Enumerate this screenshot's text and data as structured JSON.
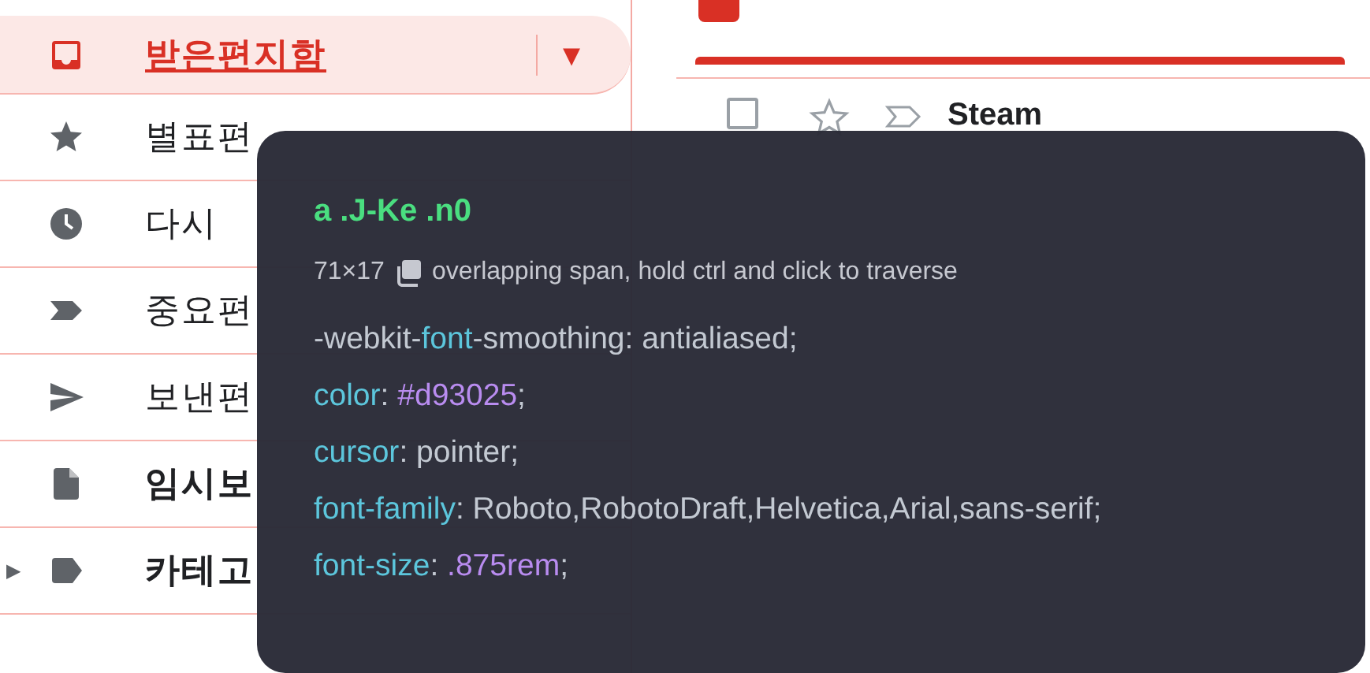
{
  "sidebar": {
    "items": [
      {
        "kind": "inbox",
        "label": "받은편지함",
        "selected": true,
        "unread": false,
        "menu": "▾"
      },
      {
        "kind": "star",
        "label": "별표편",
        "selected": false,
        "unread": false
      },
      {
        "kind": "clock",
        "label": "다시",
        "selected": false,
        "unread": false
      },
      {
        "kind": "important",
        "label": "중요편",
        "selected": false,
        "unread": false
      },
      {
        "kind": "send",
        "label": "보낸편",
        "selected": false,
        "unread": false
      },
      {
        "kind": "draft",
        "label": "임시보",
        "selected": false,
        "unread": true
      },
      {
        "kind": "label",
        "label": "카테고",
        "selected": false,
        "unread": true,
        "expanded": false,
        "expander": "▶"
      }
    ]
  },
  "messages": [
    {
      "sender": "Steam",
      "checked": false,
      "starred": false,
      "important": false
    }
  ],
  "inspector": {
    "selector": "a .J-Ke .n0",
    "size": "71×17",
    "note": "overlapping span, hold ctrl and click to traverse",
    "declarations": [
      [
        {
          "text": "-webkit-",
          "kind": "plain"
        },
        {
          "text": "font",
          "kind": "keyword"
        },
        {
          "text": "-smoothing: antialiased;",
          "kind": "plain"
        }
      ],
      [
        {
          "text": "color",
          "kind": "keyword"
        },
        {
          "text": ": ",
          "kind": "plain"
        },
        {
          "text": "#d93025",
          "kind": "number"
        },
        {
          "text": ";",
          "kind": "plain"
        }
      ],
      [
        {
          "text": "cursor",
          "kind": "keyword"
        },
        {
          "text": ": pointer;",
          "kind": "plain"
        }
      ],
      [
        {
          "text": "font-family",
          "kind": "keyword"
        },
        {
          "text": ": Roboto,RobotoDraft,Helvetica,Arial,sans-serif;",
          "kind": "plain"
        }
      ],
      [
        {
          "text": "font-size",
          "kind": "keyword"
        },
        {
          "text": ": ",
          "kind": "plain"
        },
        {
          "text": ".875rem",
          "kind": "number"
        },
        {
          "text": ";",
          "kind": "plain"
        }
      ]
    ]
  }
}
